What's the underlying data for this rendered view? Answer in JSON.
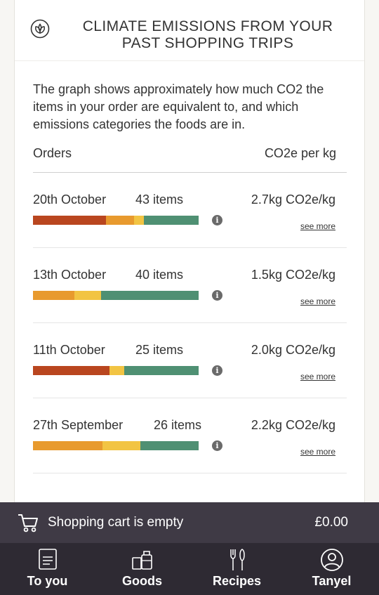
{
  "header": {
    "icon": "leaf-circle-icon",
    "title": "CLIMATE EMISSIONS FROM YOUR PAST SHOPPING TRIPS"
  },
  "description": "The graph shows approximately how much CO2 the items in your order are equivalent to, and which emissions categories the foods are in.",
  "columns": {
    "orders": "Orders",
    "co2": "CO2e per kg"
  },
  "see_more_label": "see more",
  "colors": {
    "high": "#b9461f",
    "medium": "#e89a2e",
    "low": "#f2c443",
    "very_low": "#4f9073"
  },
  "orders": [
    {
      "date": "20th October",
      "items": "43 items",
      "co2": "2.7kg CO2e/kg",
      "segments": [
        {
          "category": "high",
          "fraction": 0.44
        },
        {
          "category": "medium",
          "fraction": 0.17
        },
        {
          "category": "low",
          "fraction": 0.06
        },
        {
          "category": "very_low",
          "fraction": 0.33
        }
      ]
    },
    {
      "date": "13th October",
      "items": "40 items",
      "co2": "1.5kg CO2e/kg",
      "segments": [
        {
          "category": "medium",
          "fraction": 0.25
        },
        {
          "category": "low",
          "fraction": 0.16
        },
        {
          "category": "very_low",
          "fraction": 0.59
        }
      ]
    },
    {
      "date": "11th October",
      "items": "25 items",
      "co2": "2.0kg CO2e/kg",
      "segments": [
        {
          "category": "high",
          "fraction": 0.46
        },
        {
          "category": "low",
          "fraction": 0.09
        },
        {
          "category": "very_low",
          "fraction": 0.45
        }
      ]
    },
    {
      "date": "27th September",
      "items": "26 items",
      "co2": "2.2kg CO2e/kg",
      "segments": [
        {
          "category": "medium",
          "fraction": 0.42
        },
        {
          "category": "low",
          "fraction": 0.23
        },
        {
          "category": "very_low",
          "fraction": 0.35
        }
      ]
    }
  ],
  "cart": {
    "icon": "shopping-cart-icon",
    "status": "Shopping cart is empty",
    "total": "£0.00"
  },
  "nav": [
    {
      "icon": "document-icon",
      "label": "To you"
    },
    {
      "icon": "groceries-icon",
      "label": "Goods"
    },
    {
      "icon": "utensils-icon",
      "label": "Recipes"
    },
    {
      "icon": "user-icon",
      "label": "Tanyel"
    }
  ]
}
